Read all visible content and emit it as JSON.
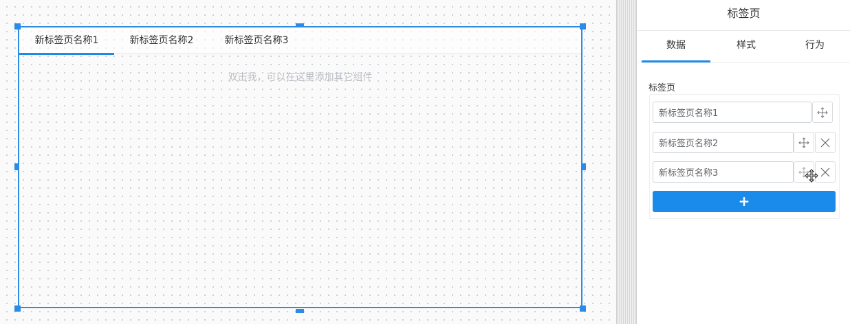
{
  "canvas": {
    "tabs": [
      {
        "label": "新标签页名称1",
        "active": true
      },
      {
        "label": "新标签页名称2",
        "active": false
      },
      {
        "label": "新标签页名称3",
        "active": false
      }
    ],
    "placeholder": "双击我，可以在这里添加其它组件",
    "accent_color": "#2b8ce8"
  },
  "panel": {
    "title": "标签页",
    "tabs": [
      {
        "label": "数据",
        "active": true
      },
      {
        "label": "样式",
        "active": false
      },
      {
        "label": "行为",
        "active": false
      }
    ],
    "section_label": "标签页",
    "items": [
      {
        "value": "新标签页名称1"
      },
      {
        "value": "新标签页名称2"
      },
      {
        "value": "新标签页名称3"
      }
    ],
    "add_label": "+"
  }
}
